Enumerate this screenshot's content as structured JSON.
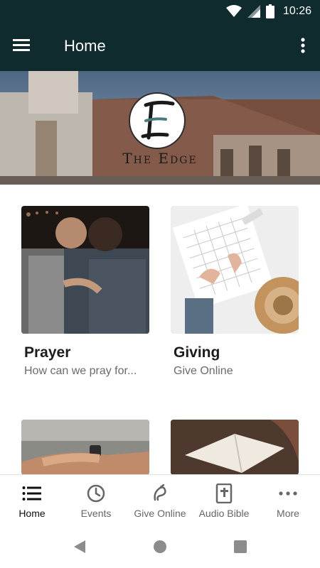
{
  "status_bar": {
    "time": "10:26",
    "icons": [
      "wifi-icon",
      "cell-signal-icon",
      "battery-icon"
    ]
  },
  "app_bar": {
    "title": "Home",
    "menu_icon": "hamburger-menu-icon",
    "overflow_icon": "more-vert-icon"
  },
  "hero": {
    "brand_name": "The Edge",
    "logo_letter": "E"
  },
  "cards": [
    {
      "title": "Prayer",
      "subtitle": "How can we pray for..."
    },
    {
      "title": "Giving",
      "subtitle": "Give Online"
    },
    {
      "title": "",
      "subtitle": ""
    },
    {
      "title": "",
      "subtitle": ""
    }
  ],
  "bottom_nav": {
    "active": "Home",
    "items": [
      {
        "label": "Home",
        "icon": "list-icon"
      },
      {
        "label": "Events",
        "icon": "clock-icon"
      },
      {
        "label": "Give Online",
        "icon": "give-icon"
      },
      {
        "label": "Audio Bible",
        "icon": "bible-icon"
      },
      {
        "label": "More",
        "icon": "more-horiz-icon"
      }
    ]
  },
  "colors": {
    "app_bar": "#0f2b2d",
    "text_primary": "#1c1c1c",
    "text_secondary": "#6b6b6b"
  }
}
